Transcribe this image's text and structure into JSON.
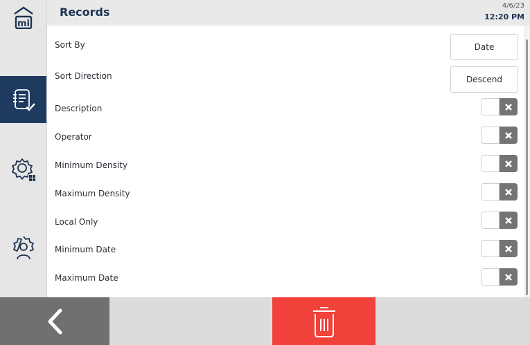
{
  "header": {
    "title": "Records",
    "date": "4/6/23",
    "time": "12:20 PM"
  },
  "sidebar": {
    "items": [
      {
        "name": "home",
        "icon": "home-logo-icon",
        "active": false
      },
      {
        "name": "records",
        "icon": "records-check-icon",
        "active": true
      },
      {
        "name": "settings-grid",
        "icon": "gear-grid-icon",
        "active": false
      },
      {
        "name": "user-settings",
        "icon": "gear-user-icon",
        "active": false
      }
    ]
  },
  "settings": {
    "sort_by": {
      "label": "Sort By",
      "value": "Date"
    },
    "sort_direction": {
      "label": "Sort Direction",
      "value": "Descend"
    },
    "toggles": [
      {
        "label": "Description",
        "on": false
      },
      {
        "label": "Operator",
        "on": false
      },
      {
        "label": "Minimum Density",
        "on": false
      },
      {
        "label": "Maximum Density",
        "on": false
      },
      {
        "label": "Local Only",
        "on": false
      },
      {
        "label": "Minimum Date",
        "on": false
      },
      {
        "label": "Maximum Date",
        "on": false
      }
    ]
  },
  "footer": {
    "back_icon": "chevron-left-icon",
    "delete_icon": "trash-icon"
  },
  "colors": {
    "accent": "#1e3a5f",
    "delete": "#f0413a",
    "toggle_off": "#747474"
  }
}
